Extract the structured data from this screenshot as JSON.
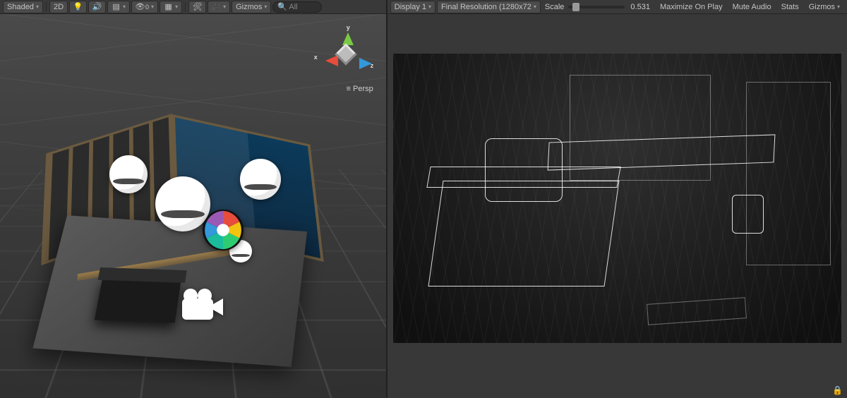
{
  "scene_toolbar": {
    "shading_mode": "Shaded",
    "button_2d": "2D",
    "gizmos_label": "Gizmos",
    "search_placeholder": "All"
  },
  "orientation_gizmo": {
    "x": "x",
    "y": "y",
    "z": "z",
    "projection": "Persp",
    "projection_prefix": "≡"
  },
  "game_toolbar": {
    "display": "Display 1",
    "resolution": "Final Resolution (1280x72",
    "scale_label": "Scale",
    "scale_value": "0.531",
    "maximize": "Maximize On Play",
    "mute": "Mute Audio",
    "stats": "Stats",
    "gizmos": "Gizmos"
  }
}
